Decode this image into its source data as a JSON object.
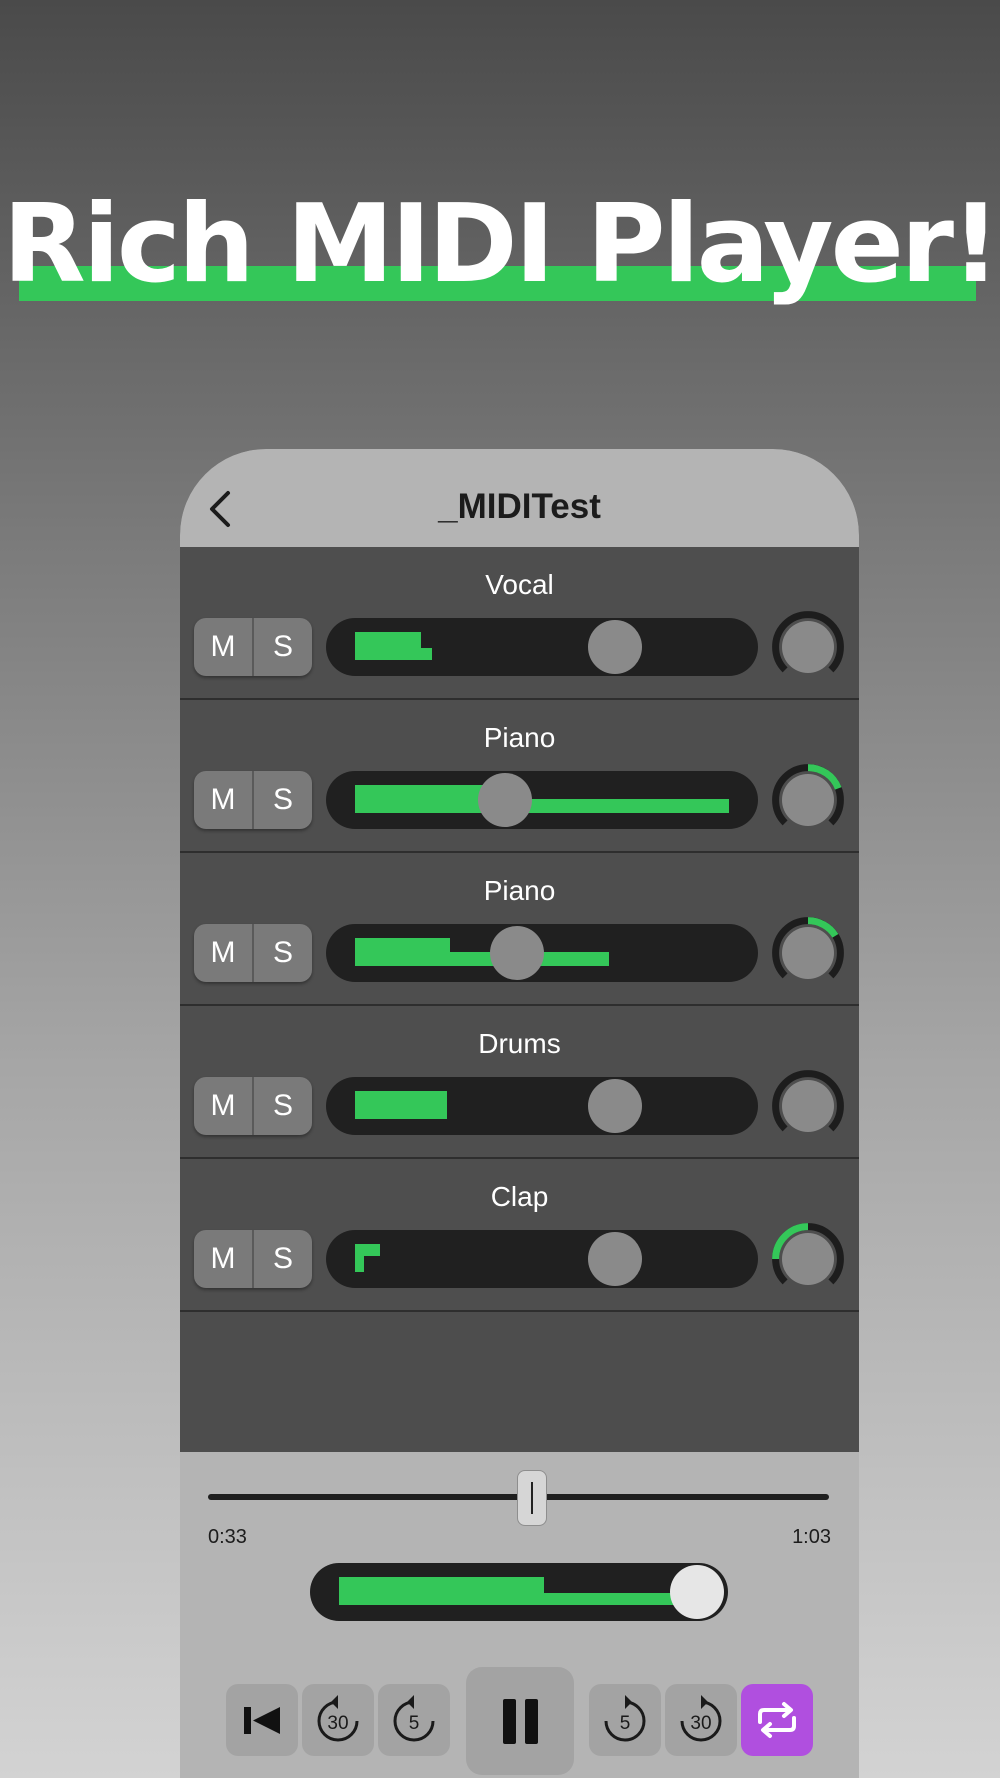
{
  "headline": "Rich MIDI Player!",
  "colors": {
    "accent": "#34c759",
    "repeat_active": "#b04fdf"
  },
  "nav": {
    "title": "_MIDITest",
    "back_icon": "chevron-left-icon"
  },
  "tracks": [
    {
      "name": "Vocal",
      "mute_label": "M",
      "solo_label": "S",
      "volume": 0.62,
      "pan": 0.0
    },
    {
      "name": "Piano",
      "mute_label": "M",
      "solo_label": "S",
      "volume": 0.38,
      "pan": 0.18
    },
    {
      "name": "Piano",
      "mute_label": "M",
      "solo_label": "S",
      "volume": 0.44,
      "pan": 0.14
    },
    {
      "name": "Drums",
      "mute_label": "M",
      "solo_label": "S",
      "volume": 0.62,
      "pan": 0.0
    },
    {
      "name": "Clap",
      "mute_label": "M",
      "solo_label": "S",
      "volume": 0.62,
      "pan": -0.22
    }
  ],
  "transport": {
    "elapsed": "0:33",
    "duration": "1:03",
    "position": 0.52,
    "master_volume": 1.0,
    "skip_back_30_label": "30",
    "skip_back_5_label": "5",
    "skip_fwd_5_label": "5",
    "skip_fwd_30_label": "30",
    "repeat_enabled": true
  }
}
